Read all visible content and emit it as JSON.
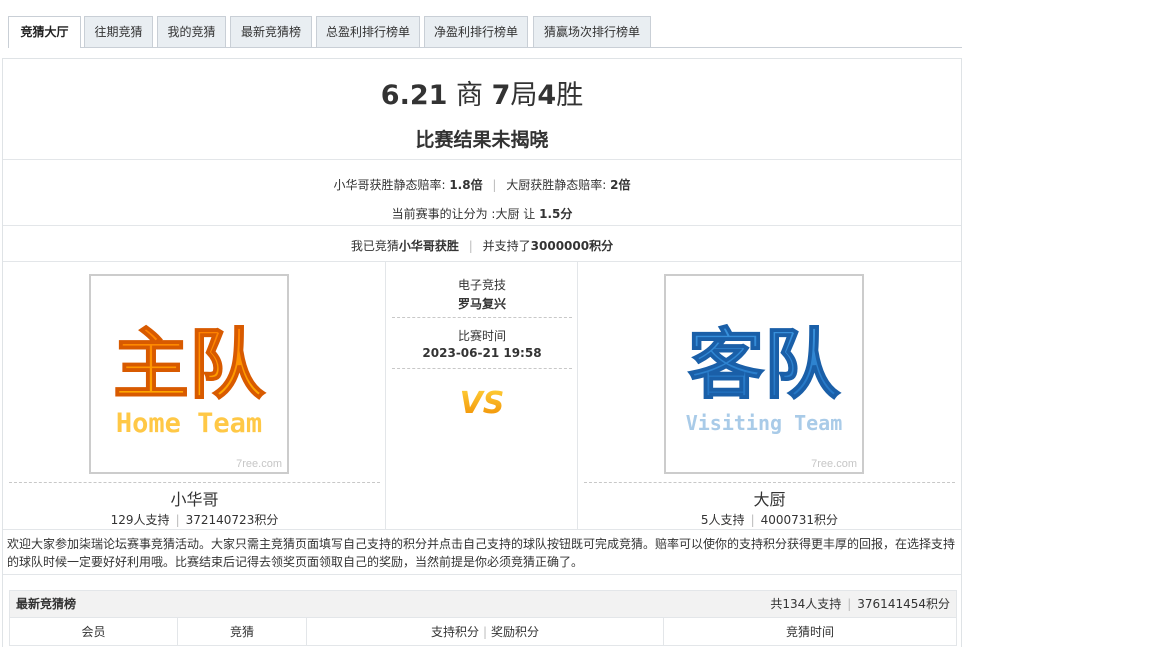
{
  "tabs": [
    {
      "label": "竞猜大厅",
      "active": true
    },
    {
      "label": "往期竞猜",
      "active": false
    },
    {
      "label": "我的竞猜",
      "active": false
    },
    {
      "label": "最新竞猜榜",
      "active": false
    },
    {
      "label": "总盈利排行榜单",
      "active": false
    },
    {
      "label": "净盈利排行榜单",
      "active": false
    },
    {
      "label": "猜赢场次排行榜单",
      "active": false
    }
  ],
  "header": {
    "date": "6.21",
    "word1": "商",
    "num1": "7",
    "word2": "局",
    "num2": "4",
    "word3": "胜",
    "status": "比赛结果未揭晓"
  },
  "odds": {
    "home_label": "小华哥获胜静态赔率:",
    "home_value": "1.8倍",
    "away_label": "大厨获胜静态赔率:",
    "away_value": "2倍"
  },
  "handicap": {
    "label": "当前赛事的让分为 :大厨 让",
    "value": "1.5分"
  },
  "my_bet": {
    "prefix": "我已竞猜",
    "choice": "小华哥获胜",
    "middle": "并支持了",
    "points": "3000000积分"
  },
  "home": {
    "logo_text": "主队",
    "logo_sub": "Home Team",
    "watermark": "7ree.com",
    "name": "小华哥",
    "supporters": "129人支持",
    "points": "372140723积分"
  },
  "away": {
    "logo_text": "客队",
    "logo_sub": "Visiting Team",
    "watermark": "7ree.com",
    "name": "大厨",
    "supporters": "5人支持",
    "points": "4000731积分"
  },
  "match": {
    "category_label": "电子竞技",
    "category_value": "罗马复兴",
    "time_label": "比赛时间",
    "time_value": "2023-06-21 19:58",
    "vs": "VS"
  },
  "intro": "欢迎大家参加柒瑞论坛赛事竞猜活动。大家只需主竞猜页面填写自己支持的积分并点击自己支持的球队按钮既可完成竞猜。赔率可以使你的支持积分获得更丰厚的回报，在选择支持的球队时候一定要好好利用哦。比赛结束后记得去领奖页面领取自己的奖励，当然前提是你必须竞猜正确了。",
  "board": {
    "title": "最新竞猜榜",
    "total_supporters": "共134人支持",
    "total_points": "376141454积分",
    "columns": [
      "会员",
      "竞猜",
      "支持积分",
      "奖励积分",
      "竞猜时间"
    ]
  },
  "colors": {
    "home_logo_top": "#ff6a00",
    "home_logo_bottom": "#ffc846",
    "away_logo_top": "#2a86d6",
    "away_logo_bottom": "#a9cbe8",
    "vs": "#f4a20c"
  }
}
